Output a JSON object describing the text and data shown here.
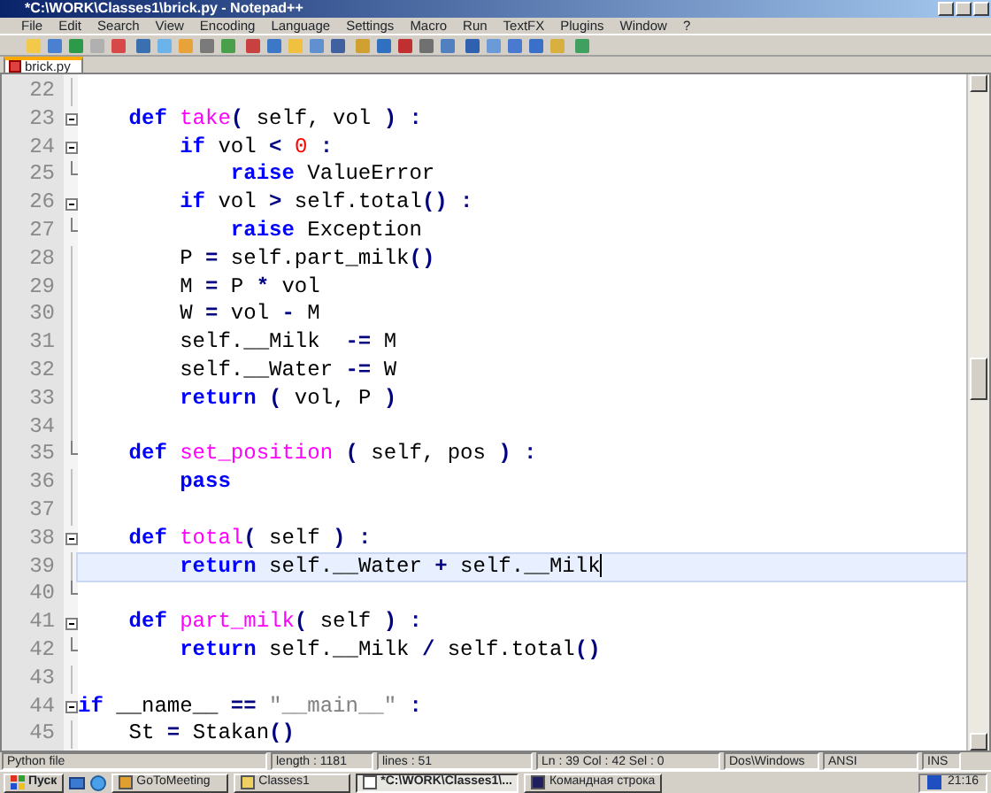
{
  "window": {
    "title": "*C:\\WORK\\Classes1\\brick.py - Notepad++"
  },
  "menu": [
    "File",
    "Edit",
    "Search",
    "View",
    "Encoding",
    "Language",
    "Settings",
    "Macro",
    "Run",
    "TextFX",
    "Plugins",
    "Window",
    "?"
  ],
  "tabs": [
    {
      "label": "brick.py",
      "selected": true
    }
  ],
  "editor": {
    "lines": [
      {
        "number": "22",
        "fold_start": false,
        "fold_end": false
      },
      {
        "number": "23",
        "fold_start": true,
        "fold_end": false,
        "tokens": [
          {
            "kind": "keyword",
            "text": "    def "
          },
          {
            "kind": "function",
            "text": "take"
          },
          {
            "kind": "operator",
            "text": "("
          },
          {
            "kind": "plain",
            "text": " self, vol "
          },
          {
            "kind": "operator",
            "text": ") :"
          }
        ]
      },
      {
        "number": "24",
        "fold_start": true,
        "fold_end": false,
        "tokens": [
          {
            "kind": "keyword",
            "text": "        if"
          },
          {
            "kind": "plain",
            "text": " vol "
          },
          {
            "kind": "operator",
            "text": "< "
          },
          {
            "kind": "number",
            "text": "0"
          },
          {
            "kind": "operator",
            "text": " :"
          }
        ]
      },
      {
        "number": "25",
        "fold_start": false,
        "fold_end": true,
        "tokens": [
          {
            "kind": "keyword",
            "text": "            raise"
          },
          {
            "kind": "plain",
            "text": " ValueError"
          }
        ]
      },
      {
        "number": "26",
        "fold_start": true,
        "fold_end": false,
        "tokens": [
          {
            "kind": "keyword",
            "text": "        if"
          },
          {
            "kind": "plain",
            "text": " vol "
          },
          {
            "kind": "operator",
            "text": ">"
          },
          {
            "kind": "plain",
            "text": " self.total"
          },
          {
            "kind": "operator",
            "text": "() :"
          }
        ]
      },
      {
        "number": "27",
        "fold_start": false,
        "fold_end": true,
        "tokens": [
          {
            "kind": "keyword",
            "text": "            raise"
          },
          {
            "kind": "plain",
            "text": " Exception"
          }
        ]
      },
      {
        "number": "28",
        "fold_start": false,
        "fold_end": false,
        "tokens": [
          {
            "kind": "plain",
            "text": "        P "
          },
          {
            "kind": "operator",
            "text": "="
          },
          {
            "kind": "plain",
            "text": " self.part_milk"
          },
          {
            "kind": "operator",
            "text": "()"
          }
        ]
      },
      {
        "number": "29",
        "fold_start": false,
        "fold_end": false,
        "tokens": [
          {
            "kind": "plain",
            "text": "        M "
          },
          {
            "kind": "operator",
            "text": "="
          },
          {
            "kind": "plain",
            "text": " P "
          },
          {
            "kind": "operator",
            "text": "*"
          },
          {
            "kind": "plain",
            "text": " vol"
          }
        ]
      },
      {
        "number": "30",
        "fold_start": false,
        "fold_end": false,
        "tokens": [
          {
            "kind": "plain",
            "text": "        W "
          },
          {
            "kind": "operator",
            "text": "="
          },
          {
            "kind": "plain",
            "text": " vol "
          },
          {
            "kind": "operator",
            "text": "-"
          },
          {
            "kind": "plain",
            "text": " M"
          }
        ]
      },
      {
        "number": "31",
        "fold_start": false,
        "fold_end": false,
        "tokens": [
          {
            "kind": "plain",
            "text": "        self.__Milk  "
          },
          {
            "kind": "operator",
            "text": "-="
          },
          {
            "kind": "plain",
            "text": " M"
          }
        ]
      },
      {
        "number": "32",
        "fold_start": false,
        "fold_end": false,
        "tokens": [
          {
            "kind": "plain",
            "text": "        self.__Water "
          },
          {
            "kind": "operator",
            "text": "-="
          },
          {
            "kind": "plain",
            "text": " W"
          }
        ]
      },
      {
        "number": "33",
        "fold_start": false,
        "fold_end": false,
        "tokens": [
          {
            "kind": "keyword",
            "text": "        return "
          },
          {
            "kind": "operator",
            "text": "("
          },
          {
            "kind": "plain",
            "text": " vol, P "
          },
          {
            "kind": "operator",
            "text": ")"
          }
        ]
      },
      {
        "number": "34",
        "fold_start": false,
        "fold_end": false
      },
      {
        "number": "35",
        "fold_start": false,
        "fold_end": true,
        "tokens": [
          {
            "kind": "keyword",
            "text": "    def "
          },
          {
            "kind": "function",
            "text": "set_position"
          },
          {
            "kind": "operator",
            "text": " ("
          },
          {
            "kind": "plain",
            "text": " self, pos "
          },
          {
            "kind": "operator",
            "text": ") :"
          }
        ]
      },
      {
        "number": "36",
        "fold_start": false,
        "fold_end": false,
        "tokens": [
          {
            "kind": "keyword",
            "text": "        pass"
          }
        ]
      },
      {
        "number": "37",
        "fold_start": false,
        "fold_end": false
      },
      {
        "number": "38",
        "fold_start": true,
        "fold_end": false,
        "tokens": [
          {
            "kind": "keyword",
            "text": "    def "
          },
          {
            "kind": "function",
            "text": "total"
          },
          {
            "kind": "operator",
            "text": "("
          },
          {
            "kind": "plain",
            "text": " self "
          },
          {
            "kind": "operator",
            "text": ") :"
          }
        ]
      },
      {
        "number": "39",
        "fold_start": false,
        "fold_end": false,
        "current": true,
        "tokens": [
          {
            "kind": "keyword",
            "text": "        return"
          },
          {
            "kind": "plain",
            "text": " self.__Water "
          },
          {
            "kind": "operator",
            "text": "+"
          },
          {
            "kind": "plain",
            "text": " self.__Milk"
          }
        ]
      },
      {
        "number": "40",
        "fold_start": false,
        "fold_end": true
      },
      {
        "number": "41",
        "fold_start": true,
        "fold_end": false,
        "tokens": [
          {
            "kind": "keyword",
            "text": "    def "
          },
          {
            "kind": "function",
            "text": "part_milk"
          },
          {
            "kind": "operator",
            "text": "("
          },
          {
            "kind": "plain",
            "text": " self "
          },
          {
            "kind": "operator",
            "text": ") :"
          }
        ]
      },
      {
        "number": "42",
        "fold_start": false,
        "fold_end": true,
        "tokens": [
          {
            "kind": "keyword",
            "text": "        return"
          },
          {
            "kind": "plain",
            "text": " self.__Milk "
          },
          {
            "kind": "operator",
            "text": "/"
          },
          {
            "kind": "plain",
            "text": " self.total"
          },
          {
            "kind": "operator",
            "text": "()"
          }
        ]
      },
      {
        "number": "43",
        "fold_start": false,
        "fold_end": false
      },
      {
        "number": "44",
        "fold_start": true,
        "fold_end": false,
        "tokens": [
          {
            "kind": "keyword",
            "text": "if"
          },
          {
            "kind": "plain",
            "text": " __name__ "
          },
          {
            "kind": "operator",
            "text": "== "
          },
          {
            "kind": "string",
            "text": "\"__main__\""
          },
          {
            "kind": "operator",
            "text": " :"
          }
        ]
      },
      {
        "number": "45",
        "fold_start": false,
        "fold_end": false,
        "tokens": [
          {
            "kind": "plain",
            "text": "    St "
          },
          {
            "kind": "operator",
            "text": "="
          },
          {
            "kind": "plain",
            "text": " Stakan"
          },
          {
            "kind": "operator",
            "text": "()"
          }
        ]
      }
    ]
  },
  "status_bar": [
    "Python file",
    "length : 1181",
    "lines : 51",
    "Ln : 39   Col : 42   Sel : 0",
    "Dos\\Windows",
    "ANSI",
    "INS"
  ],
  "taskbar": {
    "start": "Пуск",
    "tasks": [
      {
        "label": "GoToMeeting",
        "selected": false
      },
      {
        "label": "Classes1",
        "selected": false
      },
      {
        "label": "*C:\\WORK\\Classes1\\...",
        "selected": true
      },
      {
        "label": "Командная строка",
        "selected": false
      }
    ],
    "clock": "21:16"
  }
}
